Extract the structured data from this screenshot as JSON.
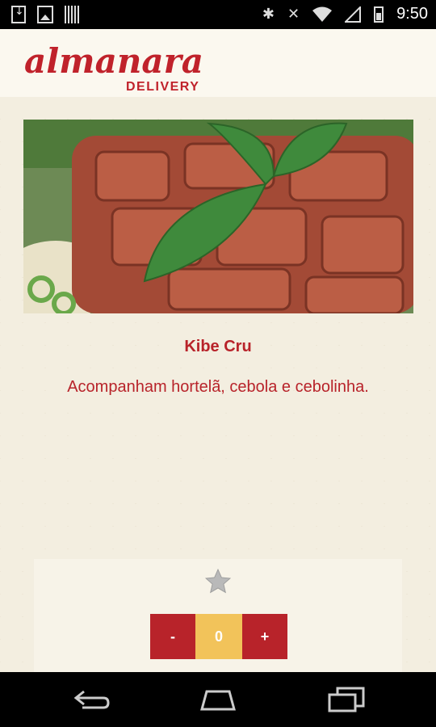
{
  "status_bar": {
    "time": "9:50"
  },
  "header": {
    "brand_name": "almanara",
    "brand_sub": "DELIVERY"
  },
  "product": {
    "name": "Kibe Cru",
    "description": "Acompanham hortelã, cebola e cebolinha."
  },
  "quantity": {
    "minus_label": "-",
    "value": "0",
    "plus_label": "+"
  },
  "colors": {
    "brand_red": "#b8232a",
    "quantity_yellow": "#f2c35a"
  },
  "icons": [
    "download-icon",
    "image-icon",
    "barcode-icon",
    "bluetooth-icon",
    "mute-icon",
    "wifi-icon",
    "no-signal-icon",
    "battery-icon",
    "favorite-star-icon",
    "back-icon",
    "home-icon",
    "recents-icon"
  ]
}
